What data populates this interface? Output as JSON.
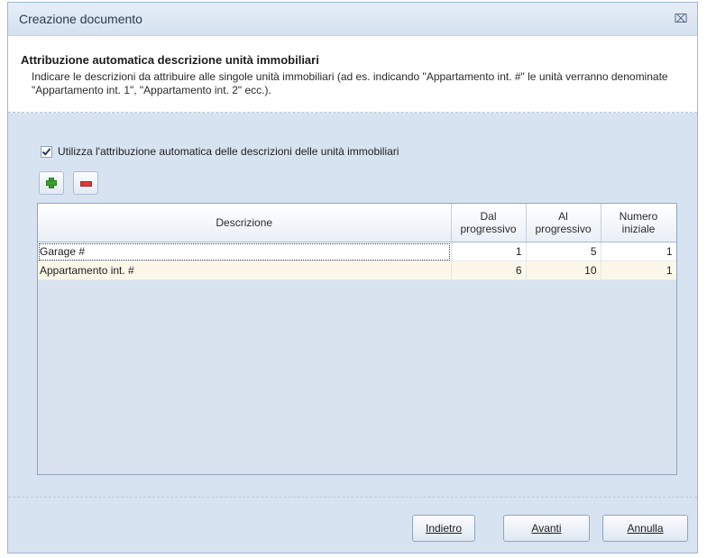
{
  "window": {
    "title": "Creazione documento",
    "close_glyph": "⌧"
  },
  "header": {
    "title": "Attribuzione automatica descrizione unità immobiliari",
    "description": "Indicare le descrizioni da attribuire alle singole unità immobiliari (ad es. indicando \"Appartamento int. #\" le unità verranno denominate \"Appartamento int. 1\", \"Appartamento int. 2\" ecc.)."
  },
  "options": {
    "auto_checkbox_label": "Utilizza l'attribuzione automatica delle descrizioni delle unità immobiliari",
    "auto_checkbox_checked": true
  },
  "toolbar": {
    "add_icon": "plus-icon",
    "remove_icon": "minus-icon"
  },
  "grid": {
    "columns": [
      {
        "label_line1": "Descrizione",
        "label_line2": ""
      },
      {
        "label_line1": "Dal",
        "label_line2": "progressivo"
      },
      {
        "label_line1": "Al",
        "label_line2": "progressivo"
      },
      {
        "label_line1": "Numero",
        "label_line2": "iniziale"
      }
    ],
    "rows": [
      {
        "descrizione": "Garage #",
        "dal": "1",
        "al": "5",
        "numero": "1"
      },
      {
        "descrizione": "Appartamento int. #",
        "dal": "6",
        "al": "10",
        "numero": "1"
      }
    ]
  },
  "buttons": {
    "back": "Indietro",
    "next": "Avanti",
    "cancel": "Annulla"
  }
}
